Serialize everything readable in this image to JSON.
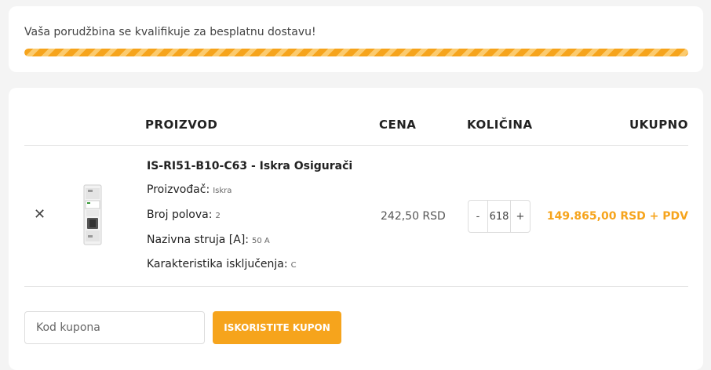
{
  "notice": {
    "text": "Vaša porudžbina se kvalifikuje za besplatnu dostavu!",
    "progress_percent": 100
  },
  "table": {
    "headers": {
      "product": "PROIZVOD",
      "price": "CENA",
      "quantity": "KOLIČINA",
      "total": "UKUPNO"
    }
  },
  "item": {
    "remove_icon": "close-icon",
    "name": "IS-RI51-B10-C63 - Iskra Osigurači",
    "attributes": [
      {
        "label": "Proizvođač:",
        "value": "Iskra"
      },
      {
        "label": "Broj polova:",
        "value": "2"
      },
      {
        "label": "Nazivna struja [A]:",
        "value": "50 A"
      },
      {
        "label": "Karakteristika isključenja:",
        "value": "C"
      }
    ],
    "unit_price": "242,50 RSD",
    "quantity": "618",
    "qty_minus": "-",
    "qty_plus": "+",
    "line_total": "149.865,00 RSD + PDV"
  },
  "coupon": {
    "placeholder": "Kod kupona",
    "button_label": "ISKORISTITE KUPON"
  },
  "colors": {
    "accent": "#f6a41c"
  }
}
